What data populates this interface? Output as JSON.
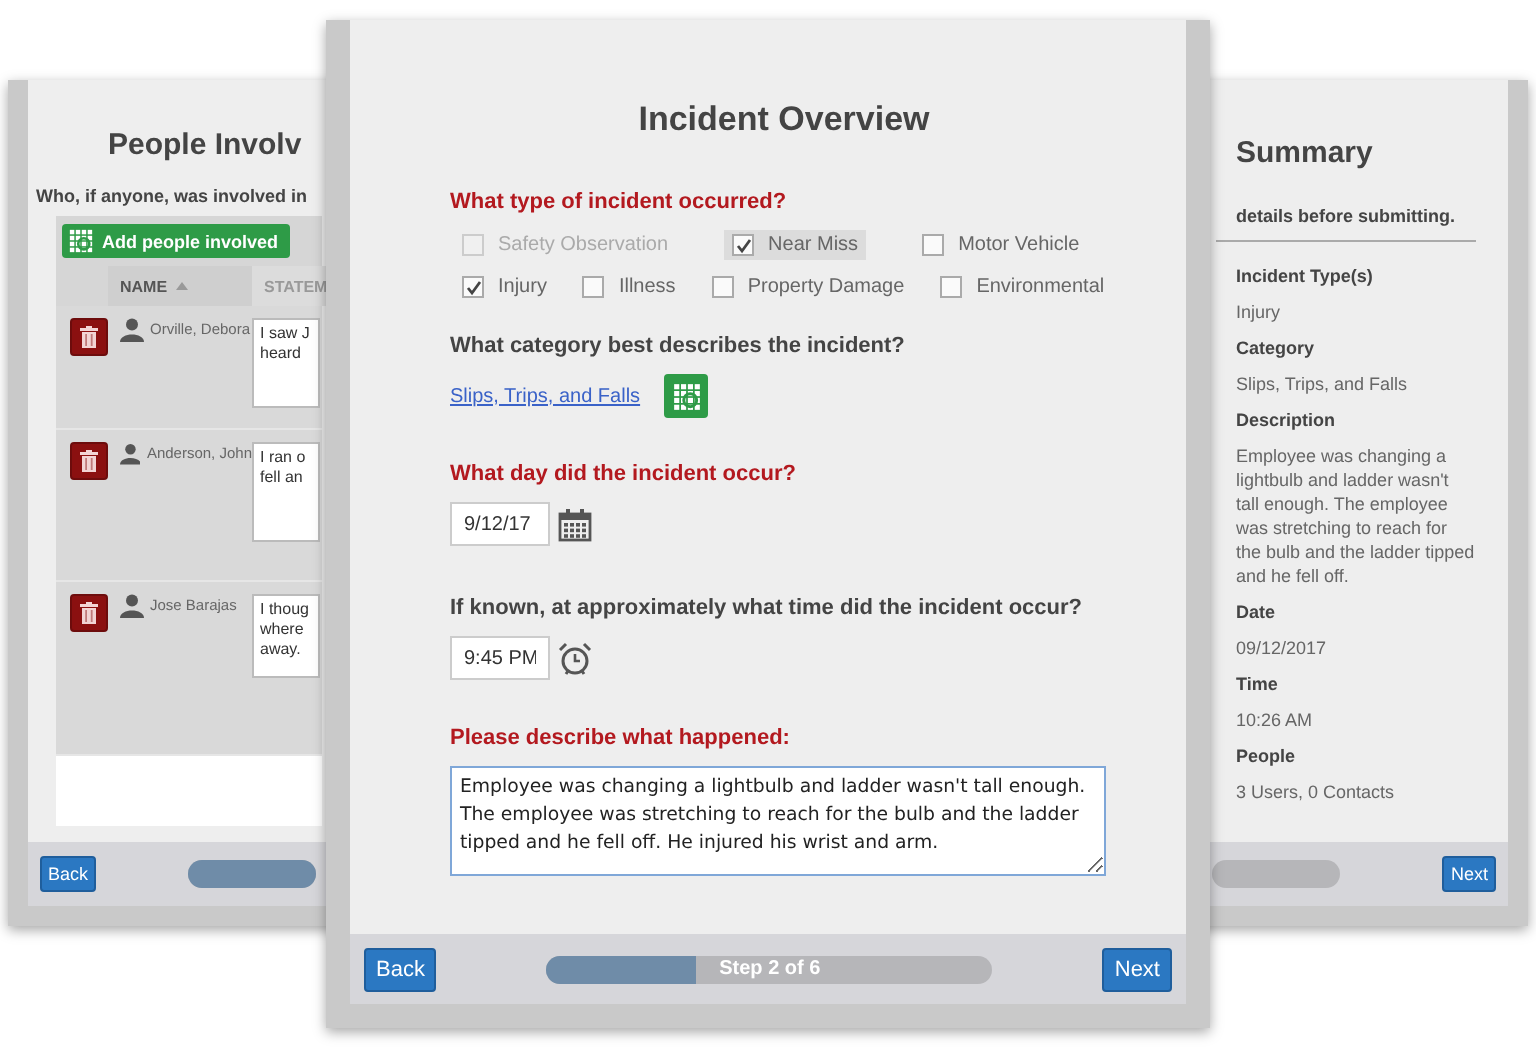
{
  "left_card": {
    "title": "People Involv",
    "question": "Who, if anyone, was involved in",
    "add_button": "Add people involved",
    "columns": [
      {
        "label": "NAME"
      },
      {
        "label": "STATEM"
      }
    ],
    "rows": [
      {
        "name": "Orville, Debora",
        "statement": "I saw J\nheard"
      },
      {
        "name": "Anderson, John",
        "statement": "I ran o\nfell an"
      },
      {
        "name": "Jose Barajas",
        "statement": "I thoug\nwhere\naway."
      }
    ],
    "back": "Back",
    "progress": {
      "level": 1
    }
  },
  "center_card": {
    "title": "Incident Overview",
    "incident_type": {
      "question": "What type of incident occurred?",
      "required": true,
      "options": [
        {
          "label": "Safety Observation",
          "checked": false,
          "disabled": true,
          "selected": false
        },
        {
          "label": "Near Miss",
          "checked": true,
          "disabled": false,
          "selected": true
        },
        {
          "label": "Motor Vehicle",
          "checked": false,
          "disabled": false,
          "selected": false
        },
        {
          "label": "Injury",
          "checked": true,
          "disabled": false,
          "selected": false
        },
        {
          "label": "Illness",
          "checked": false,
          "disabled": false,
          "selected": false
        },
        {
          "label": "Property Damage",
          "checked": false,
          "disabled": false,
          "selected": false
        },
        {
          "label": "Environmental",
          "checked": false,
          "disabled": false,
          "selected": false
        }
      ]
    },
    "category": {
      "question": "What category best describes the incident?",
      "required": false,
      "value": "Slips, Trips, and Falls"
    },
    "date": {
      "question": "What day did the incident occur?",
      "required": true,
      "value": "9/12/17"
    },
    "time": {
      "question": "If known, at approximately what time did the incident occur?",
      "required": false,
      "value": "9:45 PM"
    },
    "description": {
      "question": "Please describe what happened:",
      "required": true,
      "value": "Employee was changing a lightbulb and ladder wasn't tall enough. The employee was stretching to reach for the bulb and the ladder tipped and he fell off. He injured his wrist and arm."
    },
    "back": "Back",
    "progress": {
      "level": 0.333,
      "label": "Step 2 of 6"
    },
    "next": "Next"
  },
  "right_card": {
    "title": "Summary",
    "subtitle": "details before submitting.",
    "fields": [
      {
        "label": "Incident Type(s)",
        "value": "Injury"
      },
      {
        "label": "Category",
        "value": "Slips, Trips, and Falls"
      },
      {
        "label": "Description",
        "value": "Employee was changing a lightbulb and ladder wasn't tall enough. The employee was stretching to reach for the bulb and the ladder tipped and he fell off."
      },
      {
        "label": "Date",
        "value": "09/12/2017"
      },
      {
        "label": "Time",
        "value": "10:26 AM"
      },
      {
        "label": "People",
        "value": "3 Users, 0 Contacts"
      }
    ],
    "progress": {
      "level": 0
    },
    "next": "Next"
  }
}
